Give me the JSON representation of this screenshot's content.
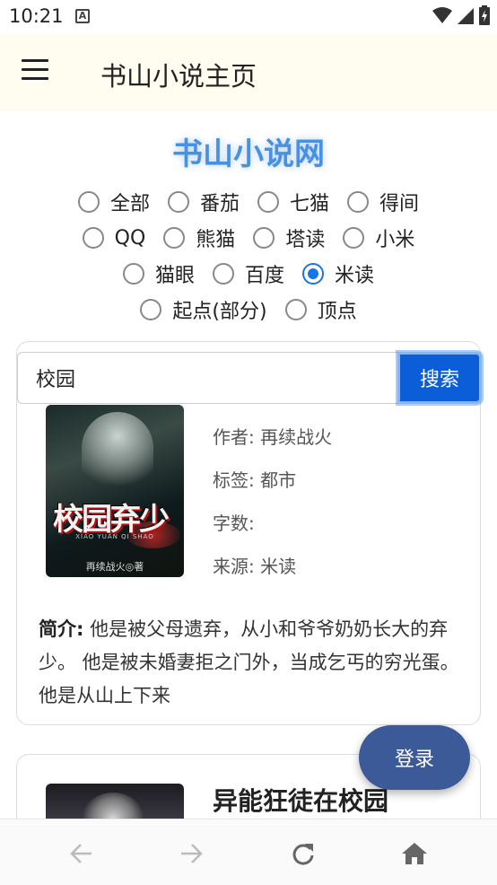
{
  "status_bar": {
    "time": "10:21",
    "notif_letter": "A"
  },
  "header": {
    "title": "书山小说主页"
  },
  "site": {
    "title": "书山小说网"
  },
  "sources": {
    "rows": [
      [
        {
          "label": "全部",
          "checked": false
        },
        {
          "label": "番茄",
          "checked": false
        },
        {
          "label": "七猫",
          "checked": false
        },
        {
          "label": "得间",
          "checked": false
        }
      ],
      [
        {
          "label": "QQ",
          "checked": false
        },
        {
          "label": "熊猫",
          "checked": false
        },
        {
          "label": "塔读",
          "checked": false
        },
        {
          "label": "小米",
          "checked": false
        }
      ],
      [
        {
          "label": "猫眼",
          "checked": false
        },
        {
          "label": "百度",
          "checked": false
        },
        {
          "label": "米读",
          "checked": true
        }
      ],
      [
        {
          "label": "起点(部分)",
          "checked": false
        },
        {
          "label": "顶点",
          "checked": false
        }
      ]
    ]
  },
  "search": {
    "value": "校园",
    "button": "搜索"
  },
  "book1": {
    "cover_title": "校园弃少",
    "cover_sub": "XIAO YUAN QI SHAO",
    "cover_author": "再续战火◎著",
    "author": "作者: 再续战火",
    "tag": "标签: 都市",
    "words": "字数:",
    "source": "来源: 米读",
    "intro_label": "简介:",
    "intro": " 他是被父母遗弃，从小和爷爷奶奶长大的弃少。 他是被未婚妻拒之门外，当成乞丐的穷光蛋。 他是从山上下来"
  },
  "book2": {
    "title": "异能狂徒在校园"
  },
  "fab": {
    "login": "登录"
  },
  "colors": {
    "accent": "#0b5ed7",
    "title_blue": "#4a90e2",
    "fab": "#3d5a98"
  }
}
